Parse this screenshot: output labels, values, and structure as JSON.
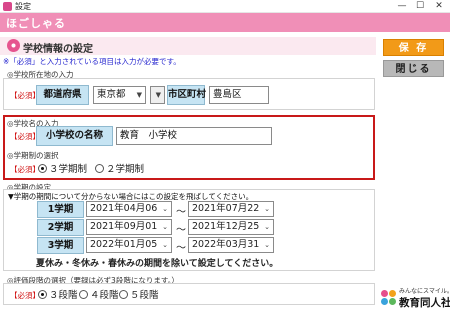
{
  "window": {
    "title": "設定",
    "minimize": "—",
    "maximize": "☐",
    "close": "✕"
  },
  "banner": {
    "logo_text": "ほごしゃる"
  },
  "section": {
    "title": "学校情報の設定",
    "note": "※「必須」と入力されている項目は入力が必要です。"
  },
  "buttons": {
    "save": "保 存",
    "close": "閉じる"
  },
  "school_location": {
    "group_label": "◎学校所在地の入力",
    "required": "【必須】",
    "pref_label": "都道府県",
    "pref_value": "東京都",
    "city_label": "市区町村",
    "city_value": "豊島区"
  },
  "school_name": {
    "group_label": "◎学校名の入力",
    "required": "【必須】",
    "label": "小学校の名称",
    "value": "教育　小学校"
  },
  "term_system": {
    "group_label": "◎学期制の選択",
    "required": "【必須】",
    "options": [
      "３学期制",
      "２学期制"
    ],
    "selected": "３学期制"
  },
  "term_periods": {
    "group_label": "◎学期の設定",
    "instruction": "▼学期の期間について分からない場合にはこの設定を飛ばしてください。",
    "terms": [
      {
        "label": "1学期",
        "start": "2021年04月06",
        "end": "2021年07月22"
      },
      {
        "label": "2学期",
        "start": "2021年09月01",
        "end": "2021年12月25"
      },
      {
        "label": "3学期",
        "start": "2022年01月05",
        "end": "2022年03月31"
      }
    ],
    "tilde": "～",
    "holiday_note": "夏休み・冬休み・春休みの期間を除いて設定してください。"
  },
  "evaluation": {
    "group_label": "◎評価段階の選択（要録は必ず3段階になります。）",
    "required": "【必須】",
    "options": [
      "３段階",
      "４段階",
      "５段階"
    ],
    "selected": "３段階"
  },
  "brand": {
    "tagline": "みんなにスマイル。",
    "name": "教育同人社"
  },
  "colors": {
    "banner": "#f08fb7",
    "required": "#d01010",
    "label_bg": "#c6e4f3",
    "highlight": "#c81919",
    "save": "#f29a18"
  }
}
